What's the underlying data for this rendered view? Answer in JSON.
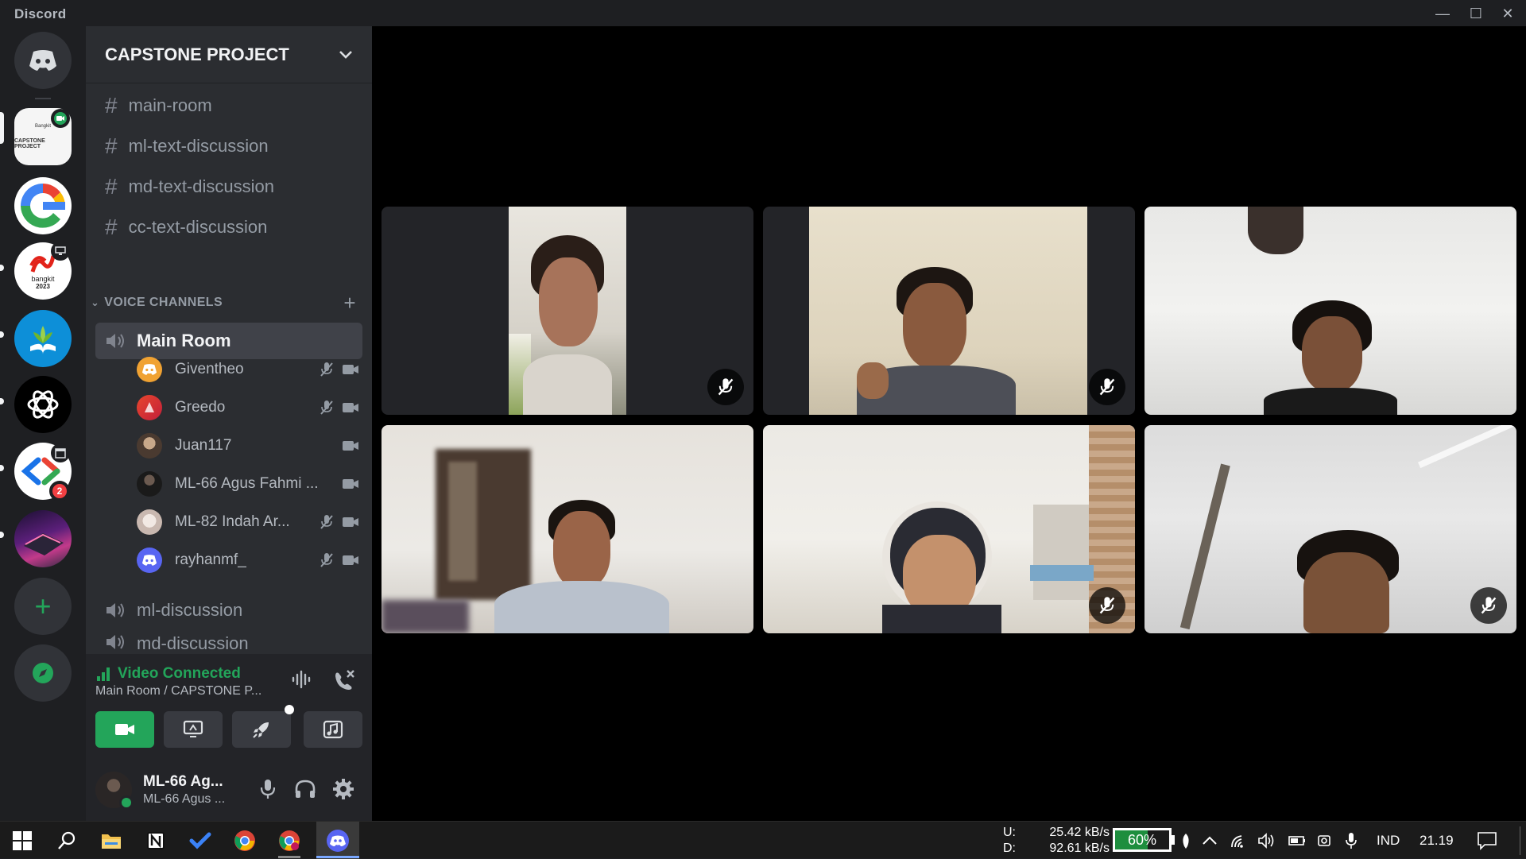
{
  "app": {
    "title": "Discord"
  },
  "window": {
    "minimize": "—",
    "maximize": "☐",
    "close": "✕"
  },
  "servers": {
    "home": "Direct Messages",
    "list": [
      {
        "name": "CAPSTONE PROJECT",
        "thumb_text": "CAPSTONE PROJECT",
        "thumb_top": "Bangkit",
        "indicator": "video"
      },
      {
        "name": "Google",
        "indicator": ""
      },
      {
        "name": "bangkit 2023",
        "thumb_text": "bangkit",
        "thumb_year": "2023",
        "indicator": "screen"
      },
      {
        "name": "Education server",
        "indicator": ""
      },
      {
        "name": "ChatGPT",
        "indicator": ""
      },
      {
        "name": "Dev server",
        "indicator": "event",
        "badge": "2"
      },
      {
        "name": "Laptop art server",
        "indicator": ""
      }
    ],
    "add": "+",
    "explore": "Explore"
  },
  "channel_sidebar": {
    "server_name": "CAPSTONE PROJECT",
    "text_channels": [
      "main-room",
      "ml-text-discussion",
      "md-text-discussion",
      "cc-text-discussion"
    ],
    "voice_header": "VOICE CHANNELS",
    "active_voice": "Main Room",
    "members": [
      {
        "name": "Giventheo",
        "avatar": "discord-orange",
        "muted": true,
        "video": true
      },
      {
        "name": "Greedo",
        "avatar": "red-pink",
        "muted": true,
        "video": true
      },
      {
        "name": "Juan117",
        "avatar": "photo-brown",
        "muted": false,
        "video": true
      },
      {
        "name": "ML-66 Agus Fahmi ...",
        "avatar": "photo-dark",
        "muted": false,
        "video": true
      },
      {
        "name": "ML-82 Indah Ar...",
        "avatar": "photo-light",
        "muted": true,
        "video": true
      },
      {
        "name": "rayhanmf_",
        "avatar": "discord-blurple",
        "muted": true,
        "video": true
      }
    ],
    "other_voice": [
      "ml-discussion",
      "md-discussion"
    ]
  },
  "voice_panel": {
    "status": "Video Connected",
    "location": "Main Room / CAPSTONE P...",
    "buttons": [
      "camera",
      "screen-share",
      "activity",
      "soundboard"
    ]
  },
  "user_panel": {
    "display_name": "ML-66 Ag...",
    "username": "ML-66 Agus ..."
  },
  "tiles": [
    {
      "muted": true
    },
    {
      "muted": true
    },
    {
      "muted": false
    },
    {
      "muted": false
    },
    {
      "muted": true
    },
    {
      "muted": true
    }
  ],
  "taskbar": {
    "upload_label": "U:",
    "download_label": "D:",
    "upload_speed": "25.42 kB/s",
    "download_speed": "92.61 kB/s",
    "battery": "60%",
    "language": "IND",
    "time": "21.19"
  },
  "colors": {
    "green": "#23a55a",
    "blurple": "#5865f2",
    "red": "#f23f42"
  }
}
